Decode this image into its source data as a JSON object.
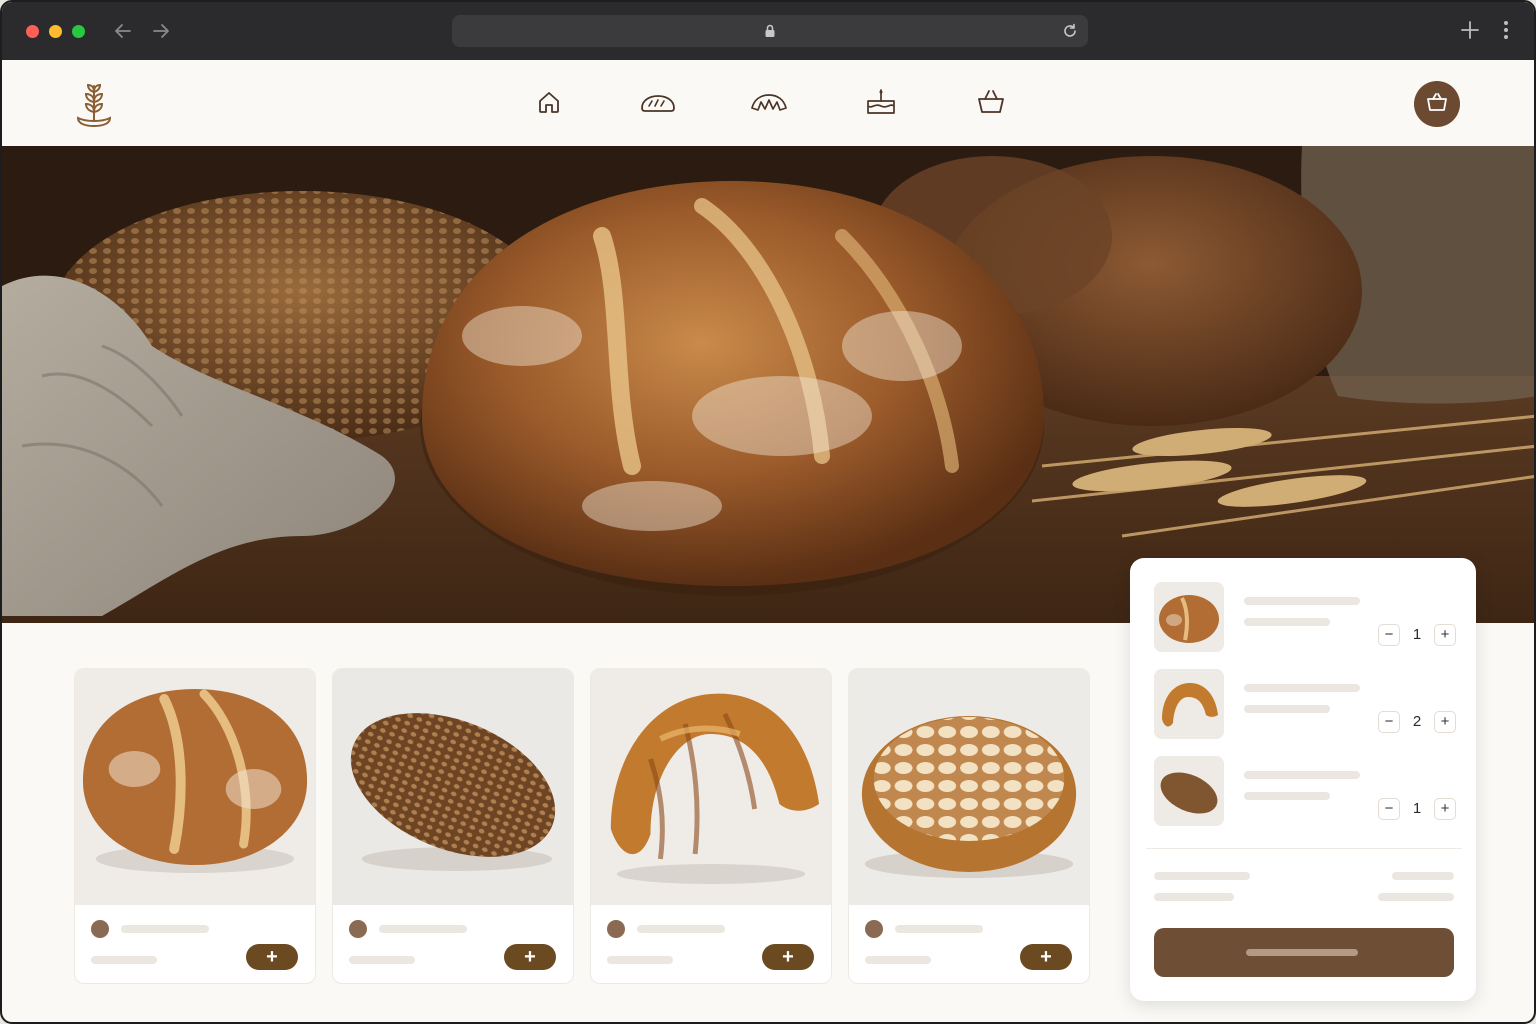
{
  "browser": {
    "icons": [
      "back-arrow-icon",
      "forward-arrow-icon",
      "lock-icon",
      "reload-icon",
      "new-tab-icon",
      "more-icon"
    ]
  },
  "header": {
    "logo": "wheat-logo-icon",
    "nav": [
      {
        "id": "home",
        "icon": "home-icon"
      },
      {
        "id": "bread",
        "icon": "bread-loaf-icon"
      },
      {
        "id": "croissant",
        "icon": "croissant-icon"
      },
      {
        "id": "cake",
        "icon": "cake-icon"
      },
      {
        "id": "basket",
        "icon": "basket-icon"
      }
    ],
    "cart_icon": "shopping-bag-icon"
  },
  "products": [
    {
      "image": "sourdough-boule",
      "add_label": "+"
    },
    {
      "image": "seeded-rye-loaf",
      "add_label": "+"
    },
    {
      "image": "croissant",
      "add_label": "+"
    },
    {
      "image": "almond-tart",
      "add_label": "+"
    }
  ],
  "cart": {
    "items": [
      {
        "image": "sourdough-boule",
        "qty": "1",
        "minus": "−",
        "plus": "+"
      },
      {
        "image": "croissant",
        "qty": "2",
        "minus": "−",
        "plus": "+"
      },
      {
        "image": "seeded-rye-loaf",
        "qty": "1",
        "minus": "−",
        "plus": "+"
      }
    ]
  },
  "colors": {
    "accent": "#6b4a31",
    "page_bg": "#fbf9f6",
    "chrome_bg": "#2b2b2d"
  }
}
